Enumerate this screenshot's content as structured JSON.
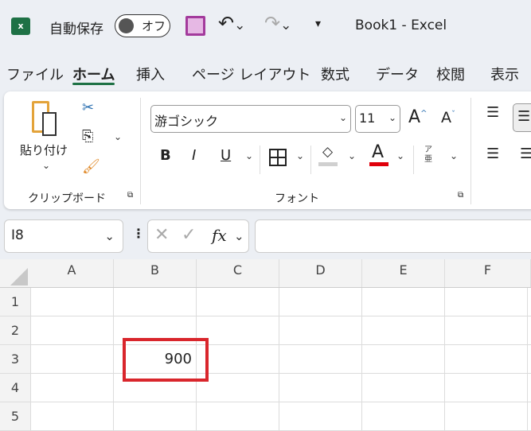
{
  "titlebar": {
    "autosave_label": "自動保存",
    "autosave_state": "オフ",
    "title": "Book1  -  Excel"
  },
  "tabs": [
    "ファイル",
    "ホーム",
    "挿入",
    "ページ レイアウト",
    "数式",
    "データ",
    "校閲",
    "表示"
  ],
  "ribbon": {
    "paste_label": "貼り付け",
    "clipboard_group": "クリップボード",
    "font_name": "游ゴシック",
    "font_size": "11",
    "font_group": "フォント",
    "bold": "B",
    "italic": "I",
    "underline": "U",
    "font_color": "A",
    "phonetic_top": "ア",
    "phonetic_bottom": "亜",
    "grow": "A",
    "shrink": "A"
  },
  "formula_bar": {
    "name_box": "I8",
    "fx": "fx",
    "value": ""
  },
  "columns": [
    "A",
    "B",
    "C",
    "D",
    "E",
    "F"
  ],
  "rows": [
    "1",
    "2",
    "3",
    "4",
    "5"
  ],
  "cells": {
    "B3": "900"
  },
  "colors": {
    "accent": "#1e7145",
    "highlight": "#d9262c"
  }
}
